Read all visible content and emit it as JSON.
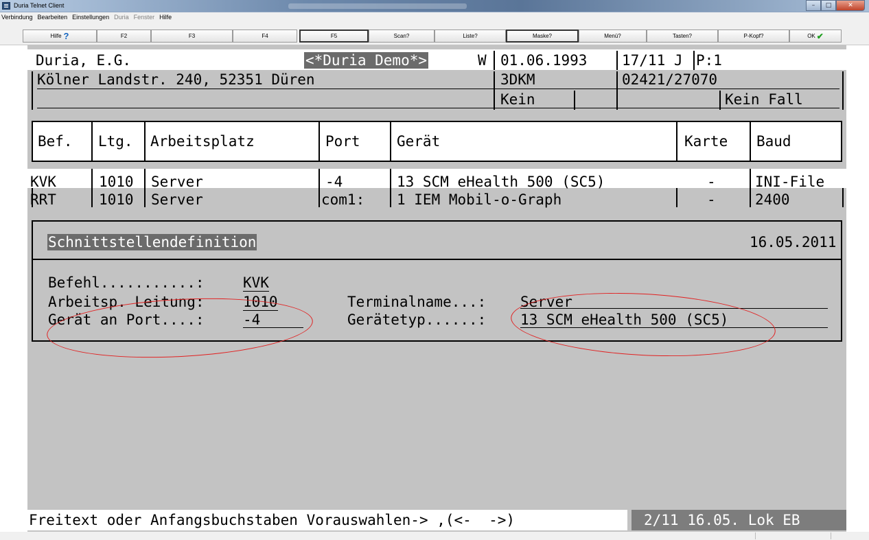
{
  "window": {
    "title": "Duria Telnet Client"
  },
  "menu": [
    "Verbindung",
    "Bearbeiten",
    "Einstellungen",
    "Duria",
    "Fenster",
    "Hilfe"
  ],
  "fkeys": [
    "Hilfe",
    "F2",
    "F3",
    "F4",
    "F5",
    "Scan?",
    "Liste?",
    "Maske?",
    "Menü?",
    "Tasten?",
    "P-Kopf?",
    "OK"
  ],
  "header": {
    "name": "Duria, E.G.",
    "demo": "<*Duria Demo*>",
    "w": "W",
    "date": "01.06.1993",
    "age": "17/11 J",
    "p": "P:1",
    "address": "Kölner Landstr. 240, 52351 Düren",
    "kv": "3DKM",
    "phone": "02421/27070",
    "kein": "Kein",
    "fall": "Kein Fall"
  },
  "table": {
    "columns": [
      "Bef.",
      "Ltg.",
      "Arbeitsplatz",
      "Port",
      "Gerät",
      "Karte",
      "Baud"
    ],
    "rows": [
      [
        "KVK",
        "1010",
        "Server",
        "-4",
        "13 SCM eHealth 500 (SC5)",
        "-",
        "INI-File"
      ],
      [
        "RRT",
        "1010",
        "Server",
        "com1:",
        "1 IEM Mobil-o-Graph",
        "-",
        "2400"
      ]
    ]
  },
  "detail": {
    "title": "Schnittstellendefinition",
    "date": "16.05.2011",
    "befehl_label": "Befehl...........:",
    "befehl": "KVK",
    "leitung_label": "Arbeitsp. Leitung:",
    "leitung": "1010",
    "port_label": "Gerät an Port....:",
    "port": "-4",
    "terminal_label": "Terminalname...:",
    "terminal": "Server",
    "typ_label": "Gerätetyp......:",
    "typ": "13 SCM eHealth 500 (SC5)"
  },
  "status": {
    "left": "Freitext oder Anfangsbuchstaben Vorauswahlen-> ,(<-  ->)",
    "right": "2/11 16.05. Lok EB"
  },
  "colors": {
    "annotation": "#e22020",
    "terminal_bg": "#c3c3c3",
    "highlight": "#6b6b6b"
  },
  "icons": {
    "help": "question-mark-icon",
    "ok": "check-icon"
  }
}
